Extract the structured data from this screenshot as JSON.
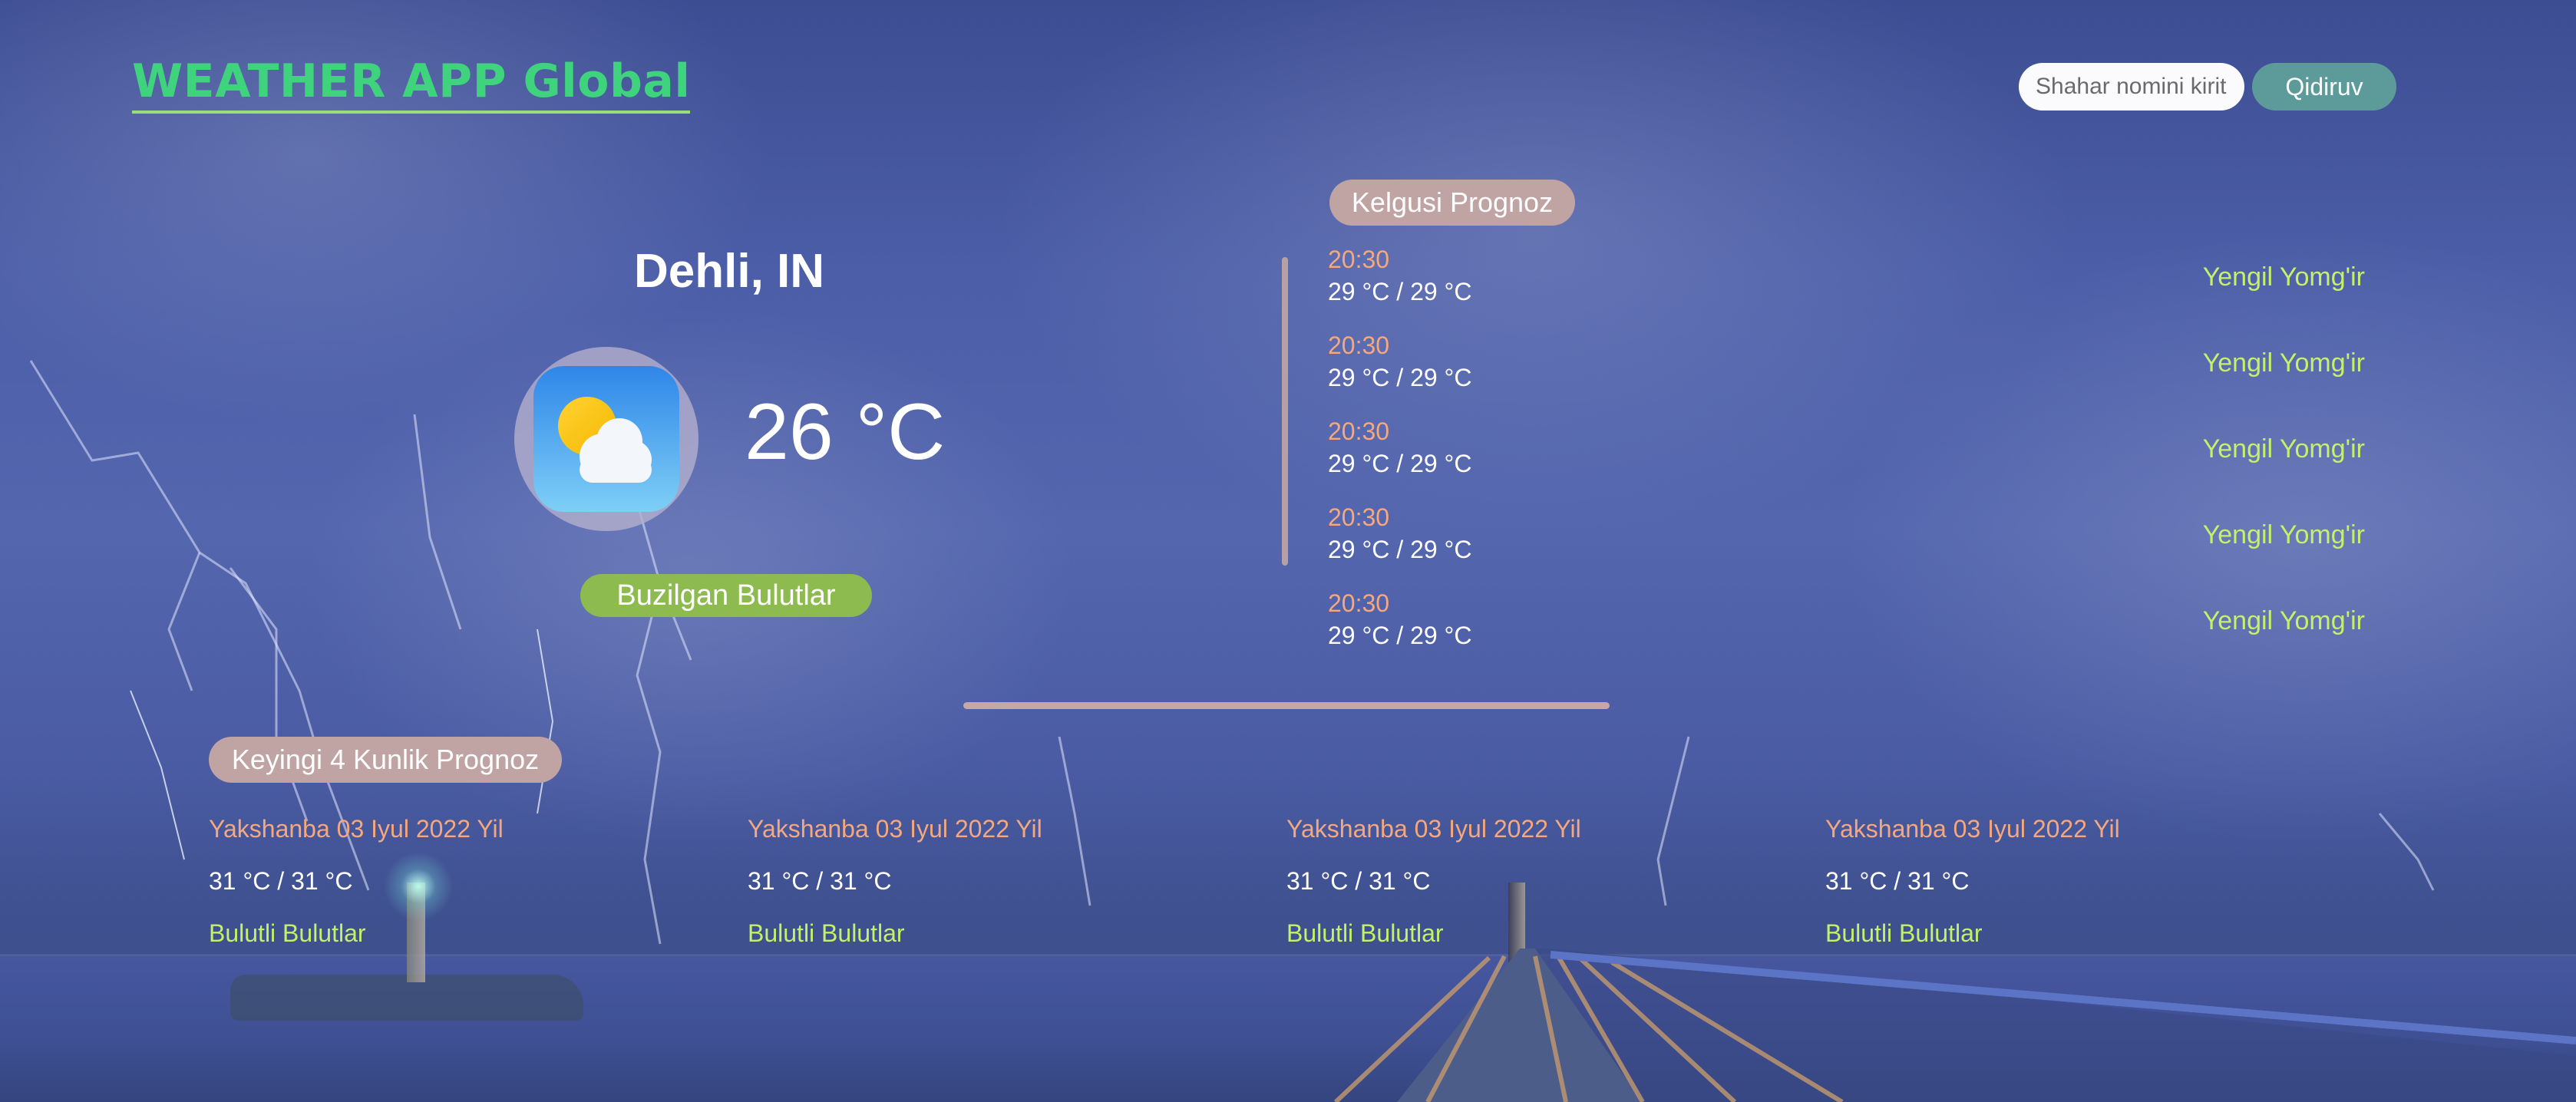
{
  "header": {
    "app_title": "WEATHER APP Global",
    "search_placeholder": "Shahar nomini kiriting",
    "search_button": "Qidiruv"
  },
  "current": {
    "city": "Dehli, IN",
    "temperature": "26 °C",
    "description": "Buzilgan Bulutlar",
    "icon": "partly-cloudy-icon"
  },
  "upcoming": {
    "title": "Kelgusi Prognoz",
    "items": [
      {
        "time": "20:30",
        "temps": "29 °C / 29 °C",
        "desc": "Yengil Yomg'ir"
      },
      {
        "time": "20:30",
        "temps": "29 °C / 29 °C",
        "desc": "Yengil Yomg'ir"
      },
      {
        "time": "20:30",
        "temps": "29 °C / 29 °C",
        "desc": "Yengil Yomg'ir"
      },
      {
        "time": "20:30",
        "temps": "29 °C / 29 °C",
        "desc": "Yengil Yomg'ir"
      },
      {
        "time": "20:30",
        "temps": "29 °C / 29 °C",
        "desc": "Yengil Yomg'ir"
      }
    ]
  },
  "days": {
    "title": "Keyingi 4 Kunlik Prognoz",
    "items": [
      {
        "date": "Yakshanba 03 Iyul 2022 Yil",
        "temps": "31 °C / 31 °C",
        "desc": "Bulutli Bulutlar"
      },
      {
        "date": "Yakshanba 03 Iyul 2022 Yil",
        "temps": "31 °C / 31 °C",
        "desc": "Bulutli Bulutlar"
      },
      {
        "date": "Yakshanba 03 Iyul 2022 Yil",
        "temps": "31 °C / 31 °C",
        "desc": "Bulutli Bulutlar"
      },
      {
        "date": "Yakshanba 03 Iyul 2022 Yil",
        "temps": "31 °C / 31 °C",
        "desc": "Bulutli Bulutlar"
      }
    ]
  },
  "colors": {
    "logo": "#3fd37e",
    "time_text": "#f5a87d",
    "description_text": "#c4f06a",
    "pill_bg": "#c0a3a3",
    "search_button": "#5d9b9a",
    "status_badge": "#8dbb50"
  }
}
